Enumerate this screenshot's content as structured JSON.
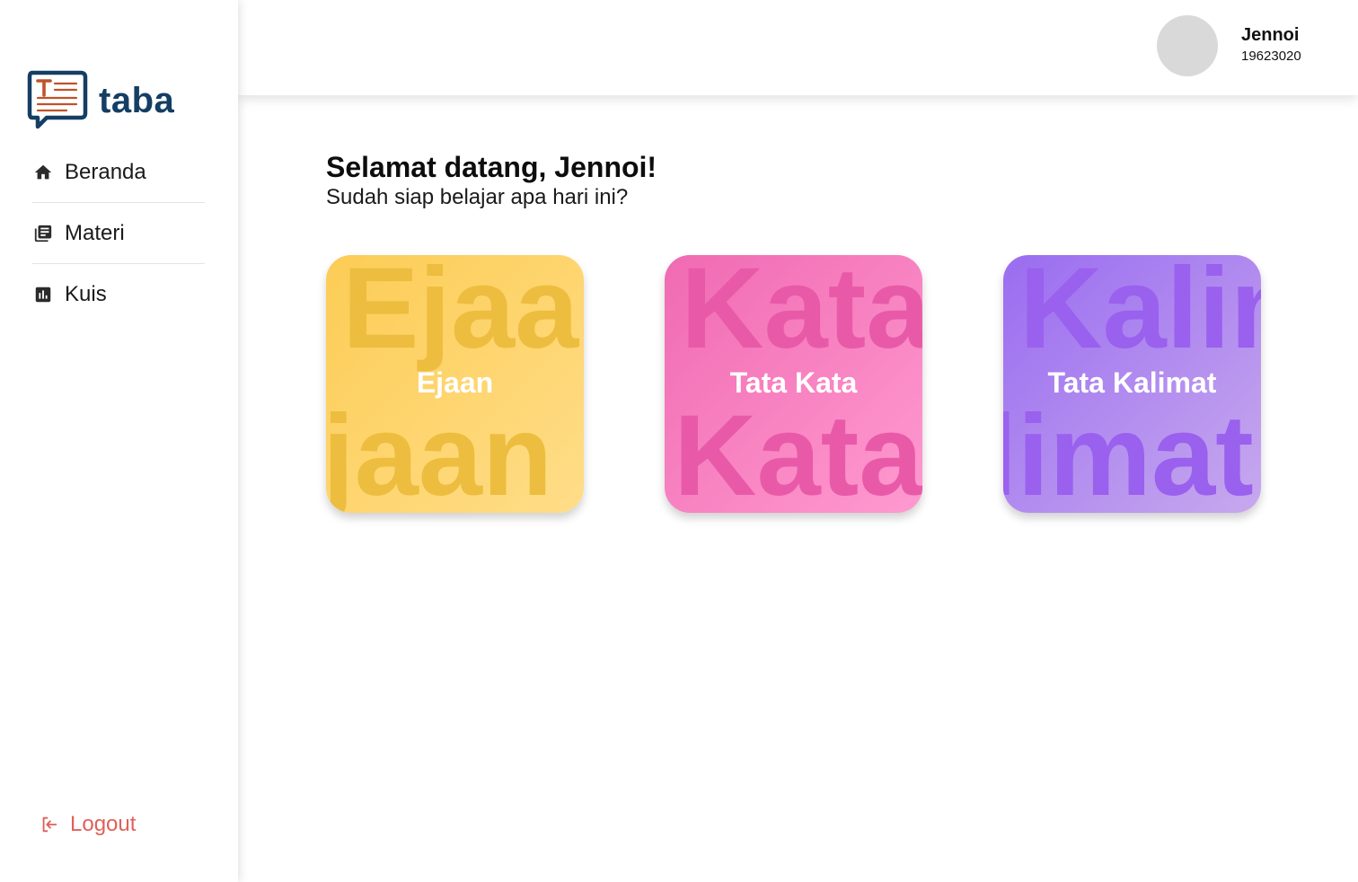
{
  "app": {
    "name": "taba"
  },
  "sidebar": {
    "items": [
      {
        "label": "Beranda",
        "icon": "home-icon"
      },
      {
        "label": "Materi",
        "icon": "book-icon"
      },
      {
        "label": "Kuis",
        "icon": "chart-icon"
      }
    ],
    "logout_label": "Logout"
  },
  "user": {
    "name": "Jennoi",
    "id": "19623020"
  },
  "main": {
    "greeting": "Selamat datang, Jennoi!",
    "subtitle": "Sudah siap belajar apa hari ini?",
    "cards": [
      {
        "title": "Ejaan",
        "bg_top": "Ejaan",
        "bg_bottom": "jaan",
        "color": "#fccc55"
      },
      {
        "title": "Tata Kata",
        "bg_top": "Kata",
        "bg_bottom": "Kata",
        "color": "#f06ab2"
      },
      {
        "title": "Tata Kalimat",
        "bg_top": "Kalim",
        "bg_bottom": "limat",
        "color": "#9a6cf0"
      }
    ]
  },
  "colors": {
    "brand": "#143e64",
    "logo_accent": "#c0522a",
    "logout": "#e0605a"
  }
}
